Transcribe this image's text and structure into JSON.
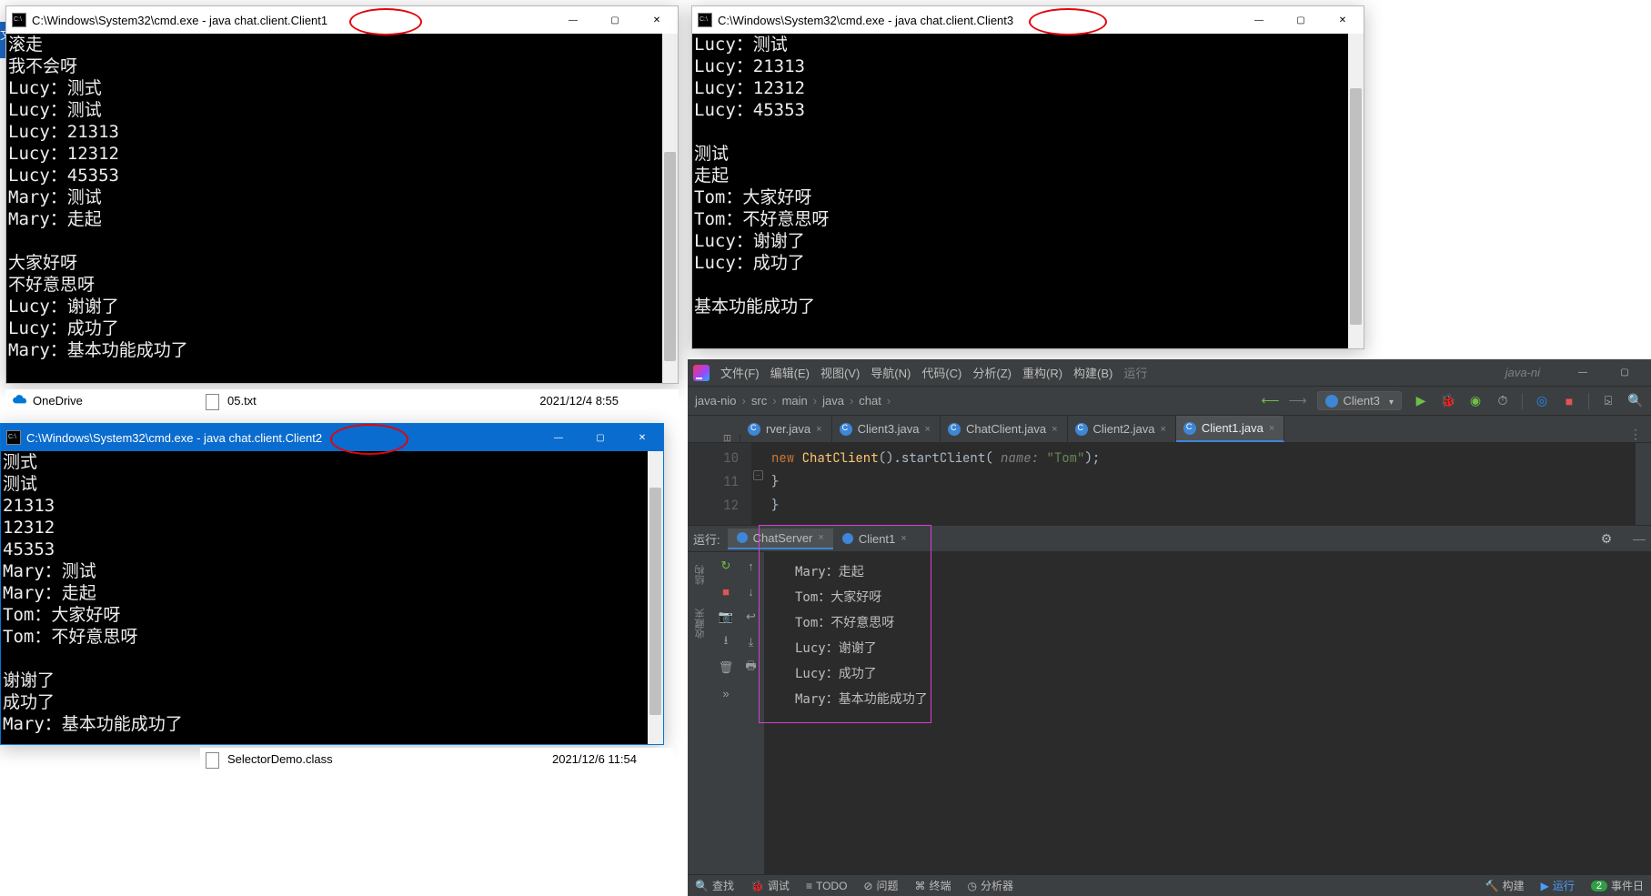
{
  "cmd1": {
    "title": "C:\\Windows\\System32\\cmd.exe - java  chat.client.Client1",
    "lines": [
      "滚走",
      "我不会呀",
      "Lucy：测式",
      "Lucy：测试",
      "Lucy：21313",
      "Lucy：12312",
      "Lucy：45353",
      "Mary：测试",
      "Mary：走起",
      "",
      "大家好呀",
      "不好意思呀",
      "Lucy：谢谢了",
      "Lucy：成功了",
      "Mary：基本功能成功了"
    ]
  },
  "cmd2": {
    "title": "C:\\Windows\\System32\\cmd.exe - java  chat.client.Client2",
    "lines": [
      "测式",
      "测试",
      "21313",
      "12312",
      "45353",
      "Mary：测试",
      "Mary：走起",
      "Tom：大家好呀",
      "Tom：不好意思呀",
      "",
      "谢谢了",
      "成功了",
      "Mary：基本功能成功了"
    ]
  },
  "cmd3": {
    "title": "C:\\Windows\\System32\\cmd.exe - java  chat.client.Client3",
    "lines": [
      "Lucy：测试",
      "Lucy：21313",
      "Lucy：12312",
      "Lucy：45353",
      "",
      "测试",
      "走起",
      "Tom：大家好呀",
      "Tom：不好意思呀",
      "Lucy：谢谢了",
      "Lucy：成功了",
      "",
      "基本功能成功了"
    ]
  },
  "explorer": {
    "onedrive": "OneDrive",
    "file1": "05.txt",
    "file1_date": "2021/12/4 8:55",
    "file2": "SelectorDemo.class",
    "file2_date": "2021/12/6 11:54"
  },
  "blue_tab": "文",
  "ide": {
    "menu": {
      "file": "文件(F)",
      "edit": "编辑(E)",
      "view": "视图(V)",
      "nav": "导航(N)",
      "code": "代码(C)",
      "analyze": "分析(Z)",
      "refactor": "重构(R)",
      "build": "构建(B)",
      "run": "运行"
    },
    "title_suffix": "java-ni",
    "breadcrumb": [
      "java-nio",
      "src",
      "main",
      "java",
      "chat"
    ],
    "run_config": "Client3",
    "tabs": [
      {
        "name": "rver.java",
        "sel": false
      },
      {
        "name": "Client3.java",
        "sel": false
      },
      {
        "name": "ChatClient.java",
        "sel": false
      },
      {
        "name": "Client2.java",
        "sel": false
      },
      {
        "name": "Client1.java",
        "sel": true
      }
    ],
    "code": {
      "lines": [
        {
          "n": "10",
          "t_kw": "new",
          "t_cls": "ChatClient",
          "t_call": ".startClient(",
          "t_name": " name: ",
          "t_str": "\"Tom\"",
          "t_end": ");"
        },
        {
          "n": "11",
          "t": "        }"
        },
        {
          "n": "12",
          "t": "    }"
        }
      ]
    },
    "run_panel": {
      "label": "运行:",
      "tabs": [
        {
          "name": "ChatServer",
          "sel": true
        },
        {
          "name": "Client1",
          "sel": false
        }
      ],
      "output": [
        "Mary：走起",
        "Tom：大家好呀",
        "Tom：不好意思呀",
        "Lucy：谢谢了",
        "Lucy：成功了",
        "Mary：基本功能成功了"
      ]
    },
    "vert_labels": [
      "结构",
      "收藏夹"
    ],
    "status": {
      "find": "查找",
      "debug": "调试",
      "todo": "TODO",
      "problems": "问题",
      "terminal": "终端",
      "profiler": "分析器",
      "build": "构建",
      "run": "运行",
      "event_n": "2",
      "event": "事件日"
    }
  }
}
